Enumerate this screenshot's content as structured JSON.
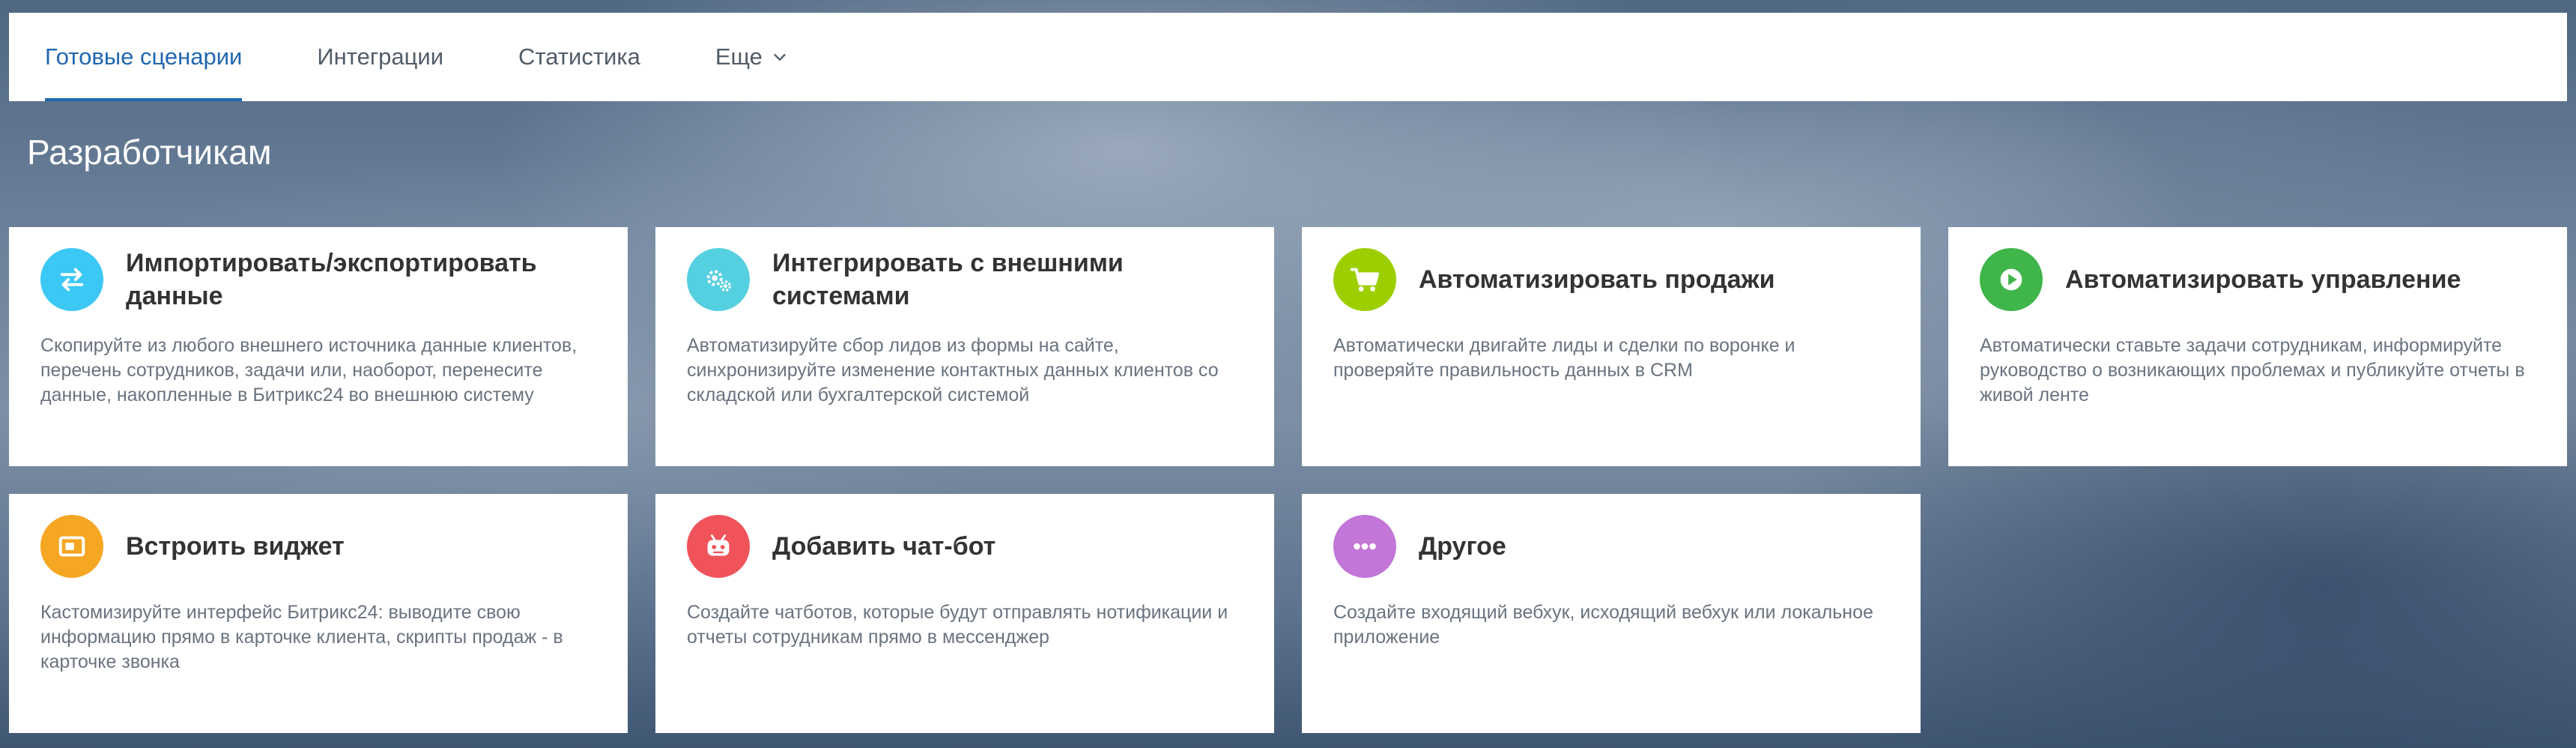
{
  "nav": {
    "tabs": [
      {
        "label": "Готовые сценарии",
        "active": true
      },
      {
        "label": "Интеграции"
      },
      {
        "label": "Статистика"
      },
      {
        "label": "Еще"
      }
    ]
  },
  "page_title": "Разработчикам",
  "colors": {
    "accent": "#2067b0",
    "icon_import": "#3bc8f5",
    "icon_integrate": "#55d0e0",
    "icon_sales": "#9dcf00",
    "icon_manage": "#3fb54a",
    "icon_widget": "#f5a623",
    "icon_chatbot": "#f0535a",
    "icon_other": "#c176d8"
  },
  "cards": [
    {
      "icon": "swap-arrows-icon",
      "title": "Импортировать/экспортировать данные",
      "description": "Скопируйте из любого внешнего источника данные клиентов, перечень сотрудников, задачи или, наоборот, перенесите данные, накопленные в Битрикс24 во внешнюю систему"
    },
    {
      "icon": "gears-icon",
      "title": "Интегрировать с внешними системами",
      "description": "Автоматизируйте сбор лидов из формы на сайте, синхронизируйте изменение контактных данных клиентов со складской или бухгалтерской системой"
    },
    {
      "icon": "cart-icon",
      "title": "Автоматизировать продажи",
      "description": "Автоматически двигайте лиды и сделки по воронке и проверяйте правильность данных в CRM"
    },
    {
      "icon": "play-icon",
      "title": "Автоматизировать управление",
      "description": "Автоматически ставьте задачи сотрудникам, информируйте руководство о возникающих проблемах и публикуйте отчеты в живой ленте"
    },
    {
      "icon": "widget-icon",
      "title": "Встроить виджет",
      "description": "Кастомизируйте интерфейс Битрикс24: выводите свою информацию прямо в карточке клиента, скрипты продаж - в карточке звонка"
    },
    {
      "icon": "robot-icon",
      "title": "Добавить чат-бот",
      "description": "Создайте чатботов, которые будут отправлять нотификации и отчеты сотрудникам прямо в мессенджер"
    },
    {
      "icon": "dots-icon",
      "title": "Другое",
      "description": "Создайте входящий вебхук, исходящий вебхук или локальное приложение"
    }
  ]
}
